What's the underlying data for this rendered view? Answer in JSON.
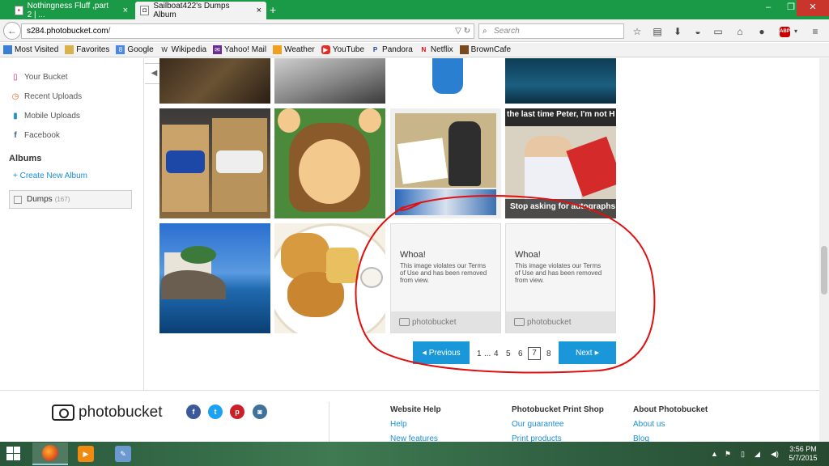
{
  "browser": {
    "tabs": [
      {
        "title": "Nothingness Fluff ,part 2 | ...",
        "active": false
      },
      {
        "title": "Sailboat422's Dumps Album",
        "active": true
      }
    ],
    "url_host": "s284.photobucket.com",
    "url_path": "/",
    "search_placeholder": "Search",
    "abp_label": "ABP",
    "bookmarks": [
      {
        "label": "Most Visited",
        "icon": "page-icon"
      },
      {
        "label": "Favorites",
        "icon": "page-icon"
      },
      {
        "label": "Google",
        "icon": "google-icon"
      },
      {
        "label": "Wikipedia",
        "icon": "wikipedia-icon"
      },
      {
        "label": "Yahoo! Mail",
        "icon": "yahoo-mail-icon"
      },
      {
        "label": "Weather",
        "icon": "weather-icon"
      },
      {
        "label": "YouTube",
        "icon": "youtube-icon"
      },
      {
        "label": "Pandora",
        "icon": "pandora-icon"
      },
      {
        "label": "Netflix",
        "icon": "netflix-icon"
      },
      {
        "label": "BrownCafe",
        "icon": "browncafe-icon"
      }
    ]
  },
  "sidebar": {
    "links": [
      {
        "label": "Your Bucket",
        "icon": "bucket-icon"
      },
      {
        "label": "Recent Uploads",
        "icon": "clock-icon"
      },
      {
        "label": "Mobile Uploads",
        "icon": "phone-icon"
      },
      {
        "label": "Facebook",
        "icon": "facebook-icon"
      }
    ],
    "albums_heading": "Albums",
    "create_album": "+ Create New Album",
    "album": {
      "name": "Dumps",
      "count": "(167)"
    }
  },
  "gallery": {
    "meme_caption_top": "the last time Peter, I'm not H",
    "meme_caption_bottom": "Stop asking for autographs",
    "removed": [
      {
        "title": "Whoa!",
        "message": "This image violates our Terms of Use and has been removed from view.",
        "brand": "photobucket"
      },
      {
        "title": "Whoa!",
        "message": "This image violates our Terms of Use and has been removed from view.",
        "brand": "photobucket"
      }
    ]
  },
  "pagination": {
    "previous": "Previous",
    "next": "Next",
    "pages": [
      "1",
      "...",
      "4",
      "5",
      "6",
      "7",
      "8"
    ],
    "current": "7"
  },
  "footer": {
    "logo": "photobucket",
    "columns": [
      {
        "heading": "Website Help",
        "links": [
          "Help",
          "New features"
        ]
      },
      {
        "heading": "Photobucket Print Shop",
        "links": [
          "Our guarantee",
          "Print products"
        ]
      },
      {
        "heading": "About Photobucket",
        "links": [
          "About us",
          "Blog"
        ]
      }
    ]
  },
  "taskbar": {
    "time": "3:56 PM",
    "date": "5/7/2015"
  },
  "colors": {
    "accent": "#1a97d8",
    "annotation_circle": "#e01010",
    "titlebar": "#1a9a47"
  }
}
